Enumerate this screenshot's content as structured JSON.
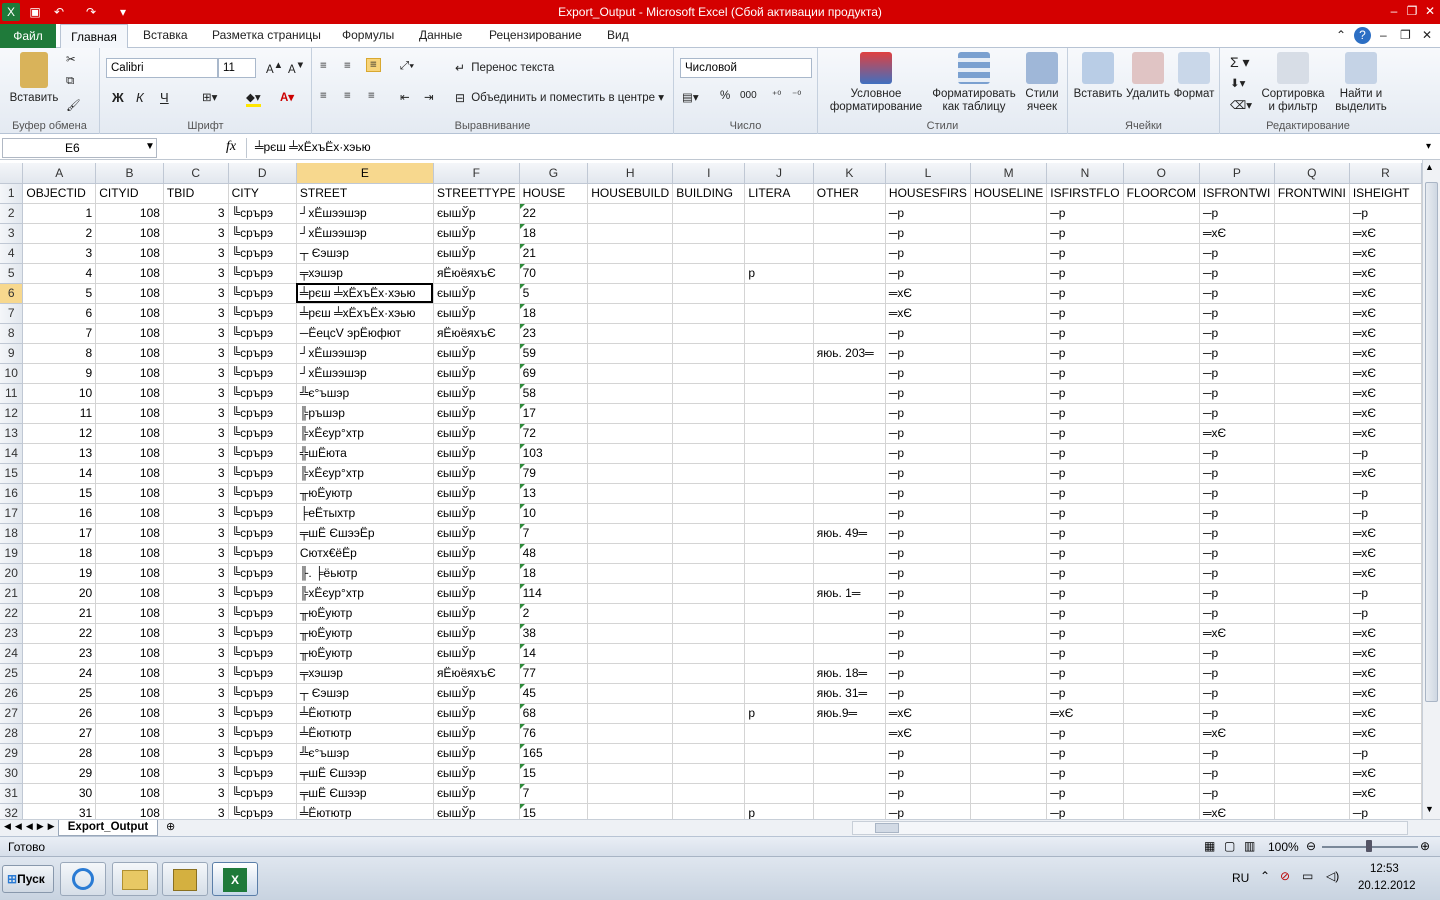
{
  "window": {
    "title": "Export_Output  -  Microsoft Excel (Сбой активации продукта)"
  },
  "ribbon_tabs": {
    "file": "Файл",
    "home": "Главная",
    "insert": "Вставка",
    "layout": "Разметка страницы",
    "formulas": "Формулы",
    "data": "Данные",
    "review": "Рецензирование",
    "view": "Вид"
  },
  "clipboard": {
    "paste": "Вставить",
    "group": "Буфер обмена"
  },
  "font": {
    "name": "Calibri",
    "size": "11",
    "group": "Шрифт",
    "bold": "Ж",
    "italic": "К",
    "underline": "Ч"
  },
  "alignment": {
    "wrap": "Перенос текста",
    "merge": "Объединить и поместить в центре",
    "group": "Выравнивание"
  },
  "number": {
    "format": "Числовой",
    "group": "Число",
    "percent": "%",
    "thousands": "000"
  },
  "styles": {
    "conditional": "Условное форматирование",
    "table": "Форматировать как таблицу",
    "cell": "Стили ячеек",
    "group": "Стили"
  },
  "cells": {
    "insert": "Вставить",
    "delete": "Удалить",
    "format": "Формат",
    "group": "Ячейки"
  },
  "editing": {
    "sort": "Сортировка и фильтр",
    "find": "Найти и выделить",
    "group": "Редактирование"
  },
  "formula_bar": {
    "namebox": "E6",
    "fx": "fx",
    "content": "╧рєш ╧хЁхъЁх·хэью"
  },
  "columns": [
    "A",
    "B",
    "C",
    "D",
    "E",
    "F",
    "G",
    "H",
    "I",
    "J",
    "K",
    "L",
    "M",
    "N",
    "O",
    "P",
    "Q",
    "R"
  ],
  "header_row": [
    "OBJECTID",
    "CITYID",
    "TBID",
    "CITY",
    "STREET",
    "STREETTYPE",
    "HOUSE",
    "HOUSEBUILD",
    "BUILDING",
    "LITERA",
    "OTHER",
    "HOUSESFIRS",
    "HOUSELINE",
    "ISFIRSTFLO",
    "FLOORCOM",
    "ISFRONTWI",
    "FRONTWINI",
    "ISHEIGHT"
  ],
  "rows": [
    [
      "1",
      "108",
      "3",
      "╚срърэ",
      "┘хЁшээшэр",
      "єышЎр",
      "22",
      "",
      "",
      "",
      "",
      "─р",
      "",
      "─р",
      "",
      "─р",
      "",
      "─р"
    ],
    [
      "2",
      "108",
      "3",
      "╚срърэ",
      "┘хЁшээшэр",
      "єышЎр",
      "18",
      "",
      "",
      "",
      "",
      "─р",
      "",
      "─р",
      "",
      "═хЄ",
      "",
      "═хЄ"
    ],
    [
      "3",
      "108",
      "3",
      "╚срърэ",
      "┬ Єэшэр",
      "єышЎр",
      "21",
      "",
      "",
      "",
      "",
      "─р",
      "",
      "─р",
      "",
      "─р",
      "",
      "═хЄ"
    ],
    [
      "4",
      "108",
      "3",
      "╚срърэ",
      "╤хэшэр",
      "яЁюёяхъЄ",
      "70",
      "",
      "",
      "р",
      "",
      "─р",
      "",
      "─р",
      "",
      "─р",
      "",
      "═хЄ"
    ],
    [
      "5",
      "108",
      "3",
      "╚срърэ",
      "╧рєш ╧хЁхъЁх·хэью",
      "єышЎр",
      "5",
      "",
      "",
      "",
      "",
      "═хЄ",
      "",
      "─р",
      "",
      "─р",
      "",
      "═хЄ"
    ],
    [
      "6",
      "108",
      "3",
      "╚срърэ",
      "╧рєш ╧хЁхъЁх·хэью",
      "єышЎр",
      "18",
      "",
      "",
      "",
      "",
      "═хЄ",
      "",
      "─р",
      "",
      "─р",
      "",
      "═хЄ"
    ],
    [
      "7",
      "108",
      "3",
      "╚срърэ",
      "─ЁецсV эрЁюфют",
      "яЁюёяхъЄ",
      "23",
      "",
      "",
      "",
      "",
      "─р",
      "",
      "─р",
      "",
      "─р",
      "",
      "═хЄ"
    ],
    [
      "8",
      "108",
      "3",
      "╚срърэ",
      "┘хЁшээшэр",
      "єышЎр",
      "59",
      "",
      "",
      "",
      "яюь. 203═",
      "─р",
      "",
      "─р",
      "",
      "─р",
      "",
      "═хЄ"
    ],
    [
      "9",
      "108",
      "3",
      "╚срърэ",
      "┘хЁшээшэр",
      "єышЎр",
      "69",
      "",
      "",
      "",
      "",
      "─р",
      "",
      "─р",
      "",
      "─р",
      "",
      "═хЄ"
    ],
    [
      "10",
      "108",
      "3",
      "╚срърэ",
      "╩є°ъшэр",
      "єышЎр",
      "58",
      "",
      "",
      "",
      "",
      "─р",
      "",
      "─р",
      "",
      "─р",
      "",
      "═хЄ"
    ],
    [
      "11",
      "108",
      "3",
      "╚срърэ",
      "╠ръшэр",
      "єышЎр",
      "17",
      "",
      "",
      "",
      "",
      "─р",
      "",
      "─р",
      "",
      "─р",
      "",
      "═хЄ"
    ],
    [
      "12",
      "108",
      "3",
      "╚срърэ",
      "╠хЁєур°хтр",
      "єышЎр",
      "72",
      "",
      "",
      "",
      "",
      "─р",
      "",
      "─р",
      "",
      "═хЄ",
      "",
      "═хЄ"
    ],
    [
      "13",
      "108",
      "3",
      "╚срърэ",
      "╬шЁюта",
      "єышЎр",
      "103",
      "",
      "",
      "",
      "",
      "─р",
      "",
      "─р",
      "",
      "─р",
      "",
      "─р"
    ],
    [
      "14",
      "108",
      "3",
      "╚срърэ",
      "╠хЁєур°хтр",
      "єышЎр",
      "79",
      "",
      "",
      "",
      "",
      "─р",
      "",
      "─р",
      "",
      "─р",
      "",
      "═хЄ"
    ],
    [
      "15",
      "108",
      "3",
      "╚срърэ",
      "╥юЁуютр",
      "єышЎр",
      "13",
      "",
      "",
      "",
      "",
      "─р",
      "",
      "─р",
      "",
      "─р",
      "",
      "─р"
    ],
    [
      "16",
      "108",
      "3",
      "╚срърэ",
      "╞еЁтыхтр",
      "єышЎр",
      "10",
      "",
      "",
      "",
      "",
      "─р",
      "",
      "─р",
      "",
      "─р",
      "",
      "─р"
    ],
    [
      "17",
      "108",
      "3",
      "╚срърэ",
      "╤шЁ ЄшээЁр",
      "єышЎр",
      "7",
      "",
      "",
      "",
      "яюь. 49═",
      "─р",
      "",
      "─р",
      "",
      "─р",
      "",
      "═хЄ"
    ],
    [
      "18",
      "108",
      "3",
      "╚срърэ",
      "Сютх€ёЁр",
      "єышЎр",
      "48",
      "",
      "",
      "",
      "",
      "─р",
      "",
      "─р",
      "",
      "─р",
      "",
      "═хЄ"
    ],
    [
      "19",
      "108",
      "3",
      "╚срърэ",
      "╟. ╞ёьютр",
      "єышЎр",
      "18",
      "",
      "",
      "",
      "",
      "─р",
      "",
      "─р",
      "",
      "─р",
      "",
      "═хЄ"
    ],
    [
      "20",
      "108",
      "3",
      "╚срърэ",
      "╠хЁєур°хтр",
      "єышЎр",
      "114",
      "",
      "",
      "",
      "яюь. 1═",
      "─р",
      "",
      "─р",
      "",
      "─р",
      "",
      "─р"
    ],
    [
      "21",
      "108",
      "3",
      "╚срърэ",
      "╥юЁуютр",
      "єышЎр",
      "2",
      "",
      "",
      "",
      "",
      "─р",
      "",
      "─р",
      "",
      "─р",
      "",
      "─р"
    ],
    [
      "22",
      "108",
      "3",
      "╚срърэ",
      "╥юЁуютр",
      "єышЎр",
      "38",
      "",
      "",
      "",
      "",
      "─р",
      "",
      "─р",
      "",
      "═хЄ",
      "",
      "═хЄ"
    ],
    [
      "23",
      "108",
      "3",
      "╚срърэ",
      "╥юЁуютр",
      "єышЎр",
      "14",
      "",
      "",
      "",
      "",
      "─р",
      "",
      "─р",
      "",
      "─р",
      "",
      "═хЄ"
    ],
    [
      "24",
      "108",
      "3",
      "╚срърэ",
      "╤хэшэр",
      "яЁюёяхъЄ",
      "77",
      "",
      "",
      "",
      "яюь. 18═",
      "─р",
      "",
      "─р",
      "",
      "─р",
      "",
      "═хЄ"
    ],
    [
      "25",
      "108",
      "3",
      "╚срърэ",
      "┬ Єэшэр",
      "єышЎр",
      "45",
      "",
      "",
      "",
      "яюь. 31═",
      "─р",
      "",
      "─р",
      "",
      "─р",
      "",
      "═хЄ"
    ],
    [
      "26",
      "108",
      "3",
      "╚срърэ",
      "╧Ёютютр",
      "єышЎр",
      "68",
      "",
      "",
      "р",
      "яюь.9═",
      "═хЄ",
      "",
      "═хЄ",
      "",
      "─р",
      "",
      "═хЄ"
    ],
    [
      "27",
      "108",
      "3",
      "╚срърэ",
      "╧Ёютютр",
      "єышЎр",
      "76",
      "",
      "",
      "",
      "",
      "═хЄ",
      "",
      "─р",
      "",
      "═хЄ",
      "",
      "═хЄ"
    ],
    [
      "28",
      "108",
      "3",
      "╚срърэ",
      "╩є°ъшэр",
      "єышЎр",
      "165",
      "",
      "",
      "",
      "",
      "─р",
      "",
      "─р",
      "",
      "─р",
      "",
      "─р"
    ],
    [
      "29",
      "108",
      "3",
      "╚срърэ",
      "╤шЁ Єшээр",
      "єышЎр",
      "15",
      "",
      "",
      "",
      "",
      "─р",
      "",
      "─р",
      "",
      "─р",
      "",
      "═хЄ"
    ],
    [
      "30",
      "108",
      "3",
      "╚срърэ",
      "╤шЁ Єшээр",
      "єышЎр",
      "7",
      "",
      "",
      "",
      "",
      "─р",
      "",
      "─р",
      "",
      "─р",
      "",
      "═хЄ"
    ],
    [
      "31",
      "108",
      "3",
      "╚срърэ",
      "╧Ёютютр",
      "єышЎр",
      "15",
      "",
      "",
      "р",
      "",
      "─р",
      "",
      "─р",
      "",
      "═хЄ",
      "",
      "─р"
    ]
  ],
  "sheet_tab": "Export_Output",
  "status": {
    "ready": "Готово",
    "zoom": "100%"
  },
  "taskbar": {
    "start": "Пуск",
    "lang": "RU",
    "time": "12:53",
    "date": "20.12.2012"
  }
}
